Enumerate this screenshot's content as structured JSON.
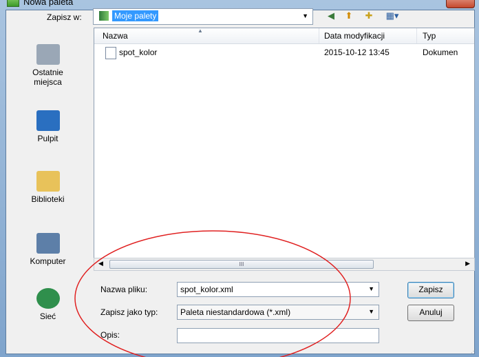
{
  "window": {
    "title": "Nowa paleta"
  },
  "toolbar": {
    "save_in_label": "Zapisz w:",
    "location": "Moje palety",
    "back_glyph": "◀",
    "up_glyph": "⬆",
    "new_folder_glyph": "✚",
    "view_glyph": "▦▾"
  },
  "places": [
    {
      "label": "Ostatnie miejsca",
      "icon": "recent-places-icon",
      "color": "#9aa7b6"
    },
    {
      "label": "Pulpit",
      "icon": "desktop-icon",
      "color": "#2a6fc0"
    },
    {
      "label": "Biblioteki",
      "icon": "libraries-icon",
      "color": "#e8c25a"
    },
    {
      "label": "Komputer",
      "icon": "computer-icon",
      "color": "#5d7fa8"
    },
    {
      "label": "Sieć",
      "icon": "network-icon",
      "color": "#2f8f4c"
    }
  ],
  "file_list": {
    "columns": [
      "Nazwa",
      "Data modyfikacji",
      "Typ"
    ],
    "rows": [
      {
        "name": "spot_kolor",
        "date": "2015-10-12 13:45",
        "type": "Dokumen"
      }
    ]
  },
  "scrollbar": {
    "thumb_glyph": "III"
  },
  "form": {
    "filename_label": "Nazwa pliku:",
    "filename_value": "spot_kolor.xml",
    "filetype_label": "Zapisz jako typ:",
    "filetype_value": "Paleta niestandardowa (*.xml)",
    "description_label": "Opis:",
    "description_value": ""
  },
  "buttons": {
    "save": "Zapisz",
    "cancel": "Anuluj"
  },
  "colors": {
    "selection": "#3399ff",
    "annotation": "#e02020"
  }
}
